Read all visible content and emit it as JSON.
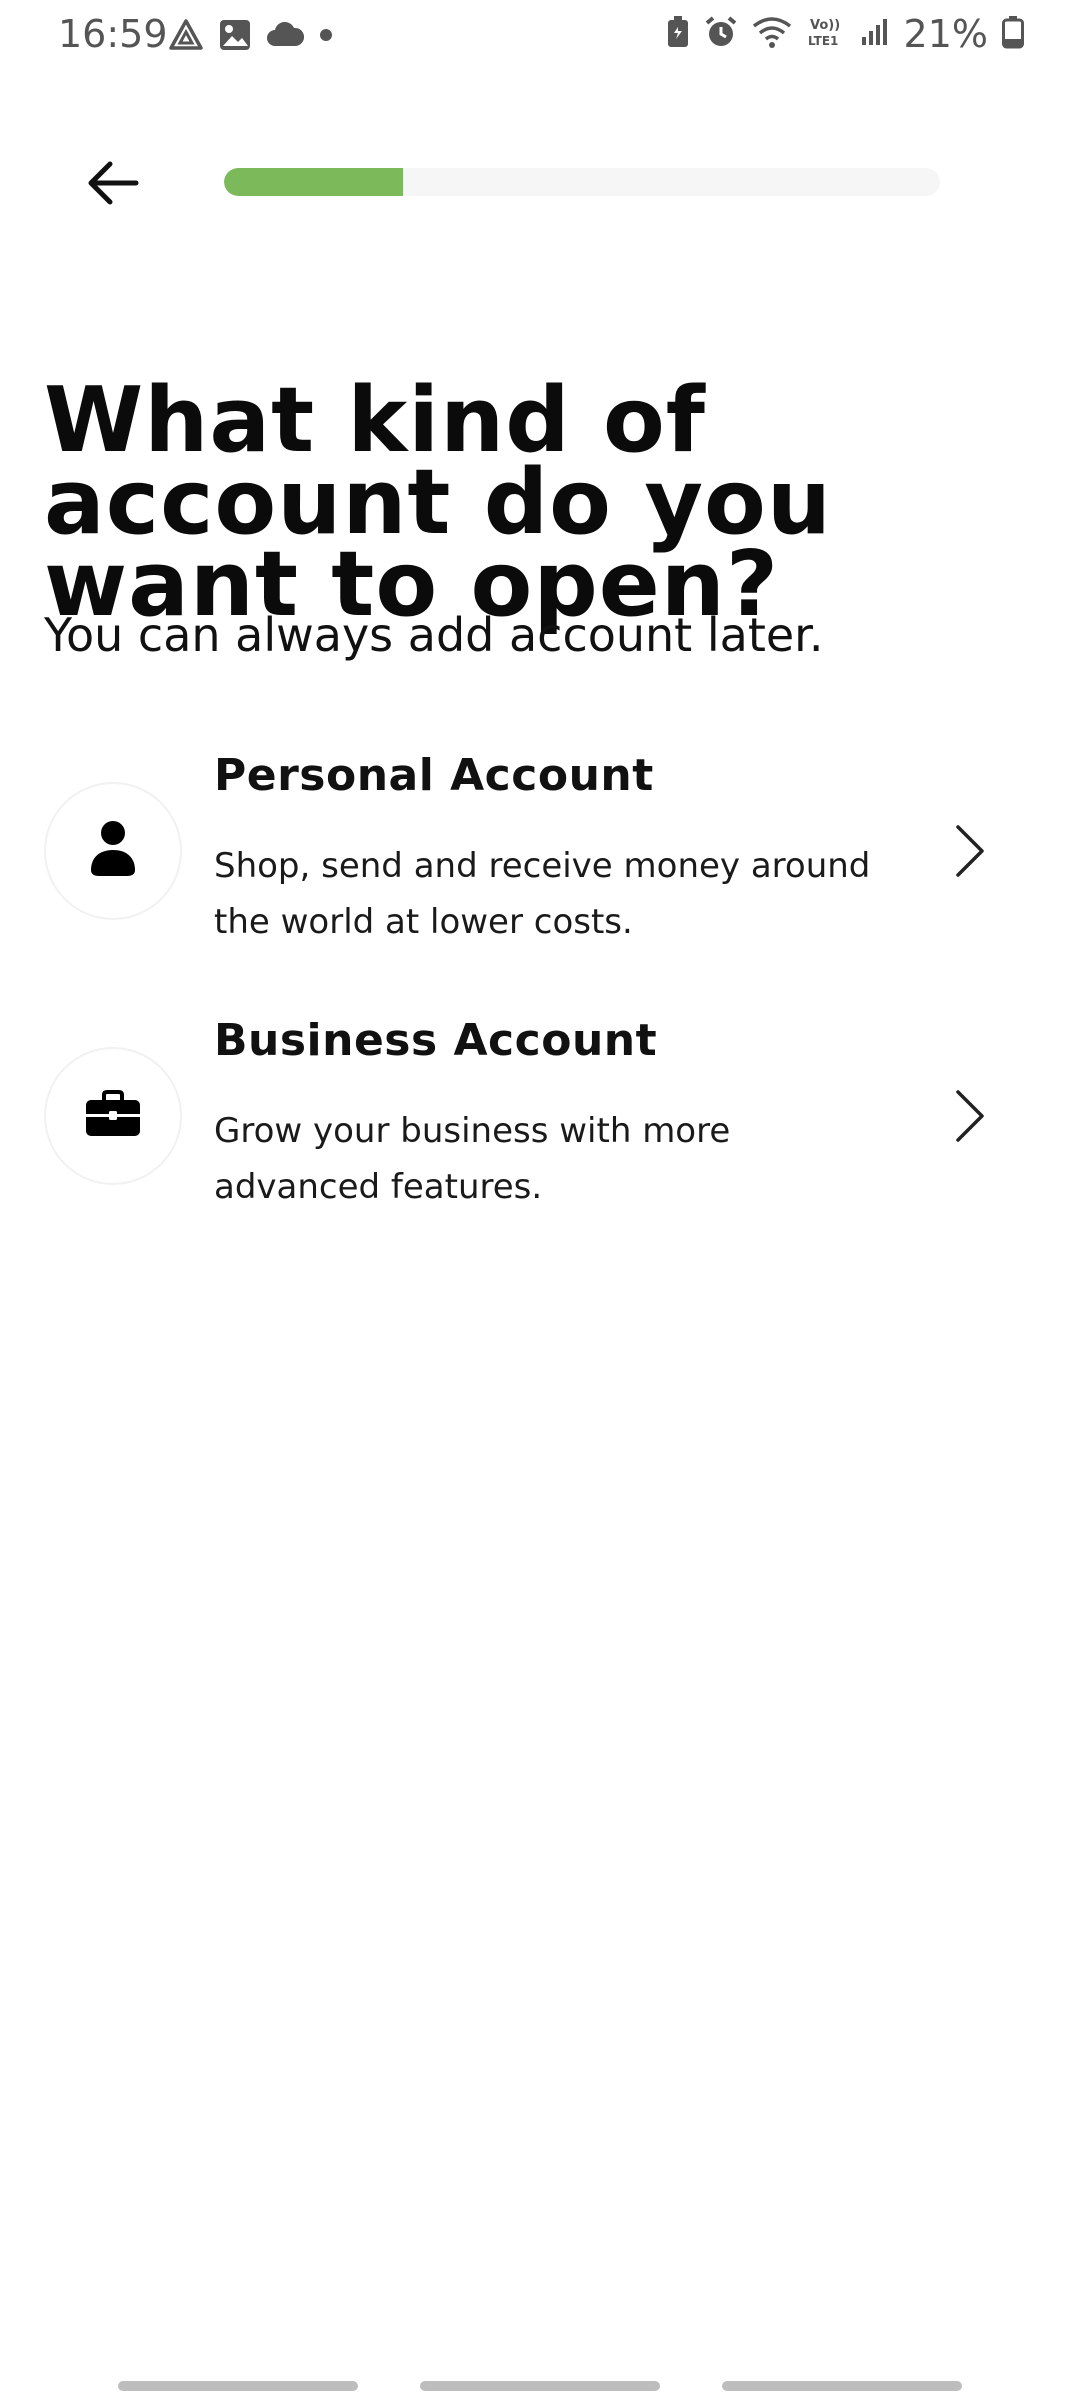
{
  "status_bar": {
    "time": "16:59",
    "battery_text": "21%",
    "left_icons": [
      "drive-icon",
      "gallery-icon",
      "cloud-icon",
      "dot-icon"
    ],
    "right_icons": [
      "battery-saver-icon",
      "alarm-icon",
      "wifi-icon",
      "volte-icon",
      "signal-icon",
      "battery-icon"
    ]
  },
  "header": {
    "back_icon": "arrow-left-icon",
    "progress_fraction": 0.25,
    "progress_color": "#7cb95a"
  },
  "main": {
    "title": "What kind of account do you want to open?",
    "subtitle": "You can always add account later.",
    "options": [
      {
        "title": "Personal Account",
        "description": "Shop, send and receive money around the world at lower costs.",
        "icon": "person-icon"
      },
      {
        "title": "Business Account",
        "description": "Grow your business with more advanced features.",
        "icon": "briefcase-icon"
      }
    ]
  }
}
